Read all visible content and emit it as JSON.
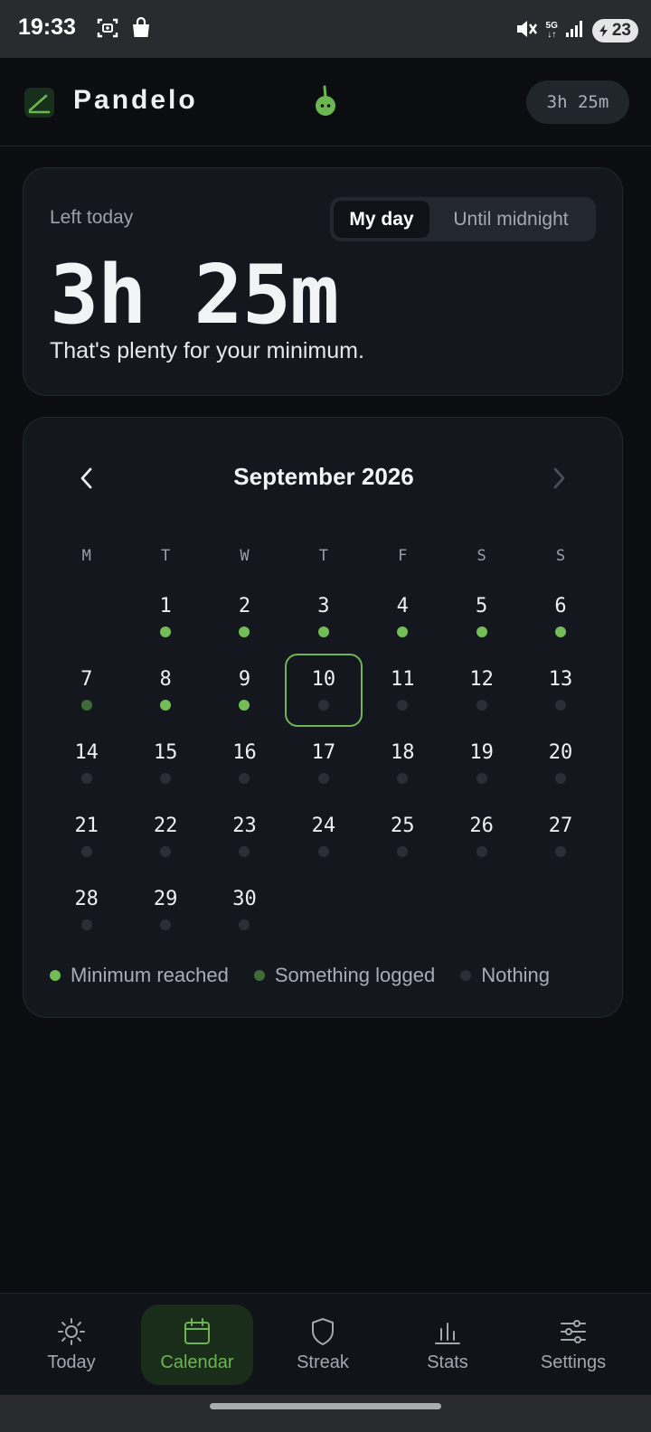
{
  "status_bar": {
    "time": "19:33",
    "network": "5G",
    "battery": "23",
    "icons": [
      "screenshot-icon",
      "shopping-bag-icon",
      "mute-icon",
      "signal-icon",
      "battery-icon"
    ]
  },
  "header": {
    "app_name": "Pandelo",
    "time_chip": "3h 25m"
  },
  "today_card": {
    "left_label": "Left today",
    "toggle_options": [
      "My day",
      "Until midnight"
    ],
    "selected_toggle": "My day",
    "time_left": "3h 25m",
    "message": "That's plenty for your minimum."
  },
  "calendar": {
    "month_title": "September 2026",
    "weekdays": [
      "M",
      "T",
      "W",
      "T",
      "F",
      "S",
      "S"
    ],
    "leading_blanks": 1,
    "today": 10,
    "days": [
      {
        "n": "1",
        "s": "min"
      },
      {
        "n": "2",
        "s": "min"
      },
      {
        "n": "3",
        "s": "min"
      },
      {
        "n": "4",
        "s": "min"
      },
      {
        "n": "5",
        "s": "min"
      },
      {
        "n": "6",
        "s": "min"
      },
      {
        "n": "7",
        "s": "some"
      },
      {
        "n": "8",
        "s": "min"
      },
      {
        "n": "9",
        "s": "min"
      },
      {
        "n": "10",
        "s": "none"
      },
      {
        "n": "11",
        "s": "none"
      },
      {
        "n": "12",
        "s": "none"
      },
      {
        "n": "13",
        "s": "none"
      },
      {
        "n": "14",
        "s": "none"
      },
      {
        "n": "15",
        "s": "none"
      },
      {
        "n": "16",
        "s": "none"
      },
      {
        "n": "17",
        "s": "none"
      },
      {
        "n": "18",
        "s": "none"
      },
      {
        "n": "19",
        "s": "none"
      },
      {
        "n": "20",
        "s": "none"
      },
      {
        "n": "21",
        "s": "none"
      },
      {
        "n": "22",
        "s": "none"
      },
      {
        "n": "23",
        "s": "none"
      },
      {
        "n": "24",
        "s": "none"
      },
      {
        "n": "25",
        "s": "none"
      },
      {
        "n": "26",
        "s": "none"
      },
      {
        "n": "27",
        "s": "none"
      },
      {
        "n": "28",
        "s": "none"
      },
      {
        "n": "29",
        "s": "none"
      },
      {
        "n": "30",
        "s": "none"
      }
    ],
    "legend": [
      {
        "label": "Minimum reached",
        "color": "#72bd55"
      },
      {
        "label": "Something logged",
        "color": "#3f6b37"
      },
      {
        "label": "Nothing",
        "color": "#2a2f37"
      }
    ]
  },
  "bottom_nav": {
    "items": [
      {
        "label": "Today",
        "icon": "sun-icon"
      },
      {
        "label": "Calendar",
        "icon": "calendar-icon"
      },
      {
        "label": "Streak",
        "icon": "shield-icon"
      },
      {
        "label": "Stats",
        "icon": "bar-chart-icon"
      },
      {
        "label": "Settings",
        "icon": "sliders-icon"
      }
    ],
    "active": "Calendar"
  },
  "colors": {
    "accent": "#6cb651",
    "background": "#0b0d11",
    "card": "#14181e"
  }
}
